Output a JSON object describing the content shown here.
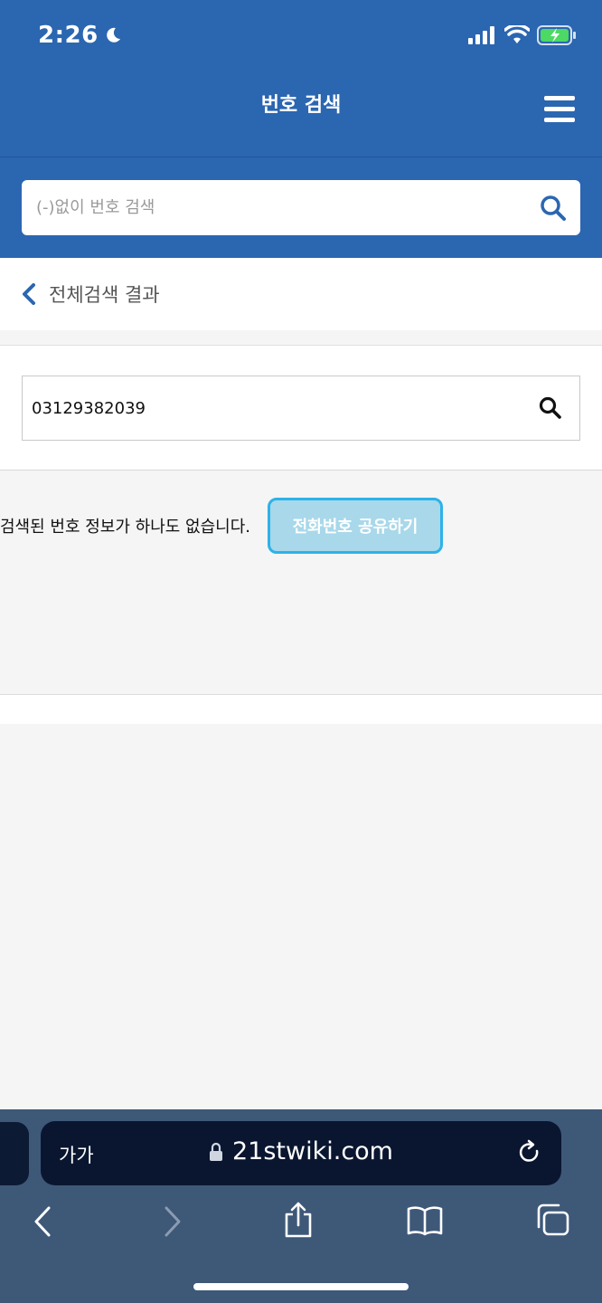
{
  "status": {
    "time": "2:26"
  },
  "header": {
    "title": "번호 검색"
  },
  "top_search": {
    "placeholder": "(-)없이 번호 검색",
    "value": ""
  },
  "back": {
    "label": "전체검색 결과"
  },
  "number_search": {
    "value": "03129382039"
  },
  "result": {
    "message": "검색된 번호 정보가 하나도 없습니다.",
    "share_label": "전화번호 공유하기"
  },
  "browser": {
    "aa_label": "가가",
    "url": "21stwiki.com"
  },
  "colors": {
    "brand": "#2b66b1",
    "share_bg": "#a8d8ea",
    "share_border": "#2db2e8"
  }
}
